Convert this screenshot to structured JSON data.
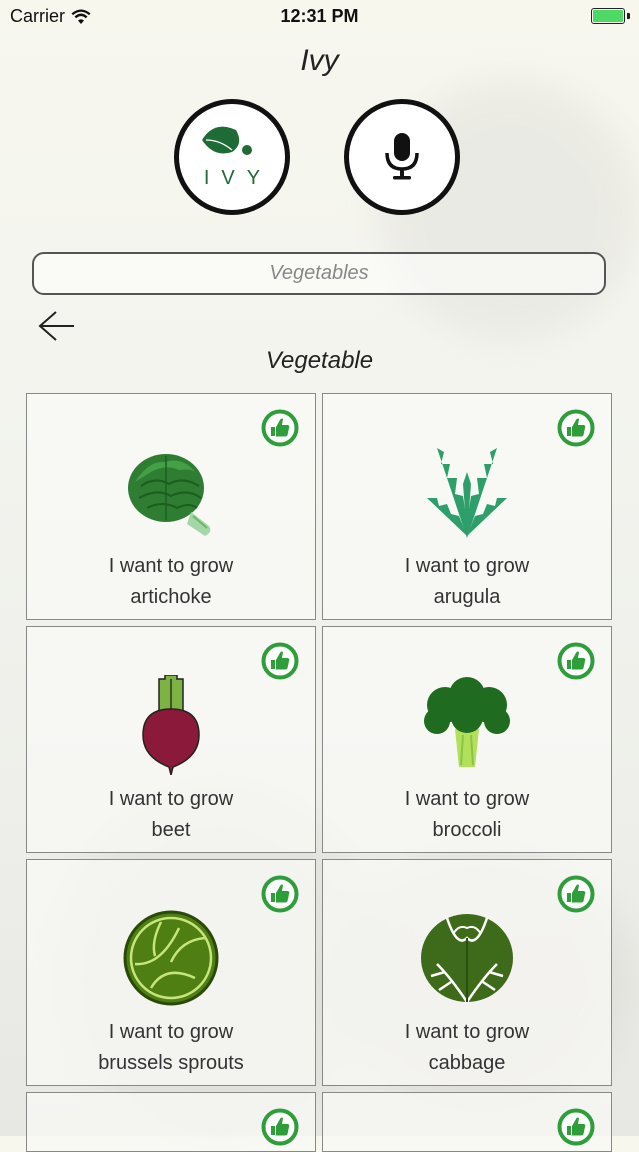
{
  "status_bar": {
    "carrier": "Carrier",
    "time": "12:31 PM"
  },
  "header": {
    "title": "Ivy",
    "logo_text": "IVY"
  },
  "search": {
    "placeholder": "Vegetables"
  },
  "section": {
    "title": "Vegetable"
  },
  "cards": [
    {
      "line1": "I want to grow",
      "line2": "artichoke",
      "icon": "artichoke-icon"
    },
    {
      "line1": "I want to grow",
      "line2": "arugula",
      "icon": "arugula-icon"
    },
    {
      "line1": "I want to grow",
      "line2": "beet",
      "icon": "beet-icon"
    },
    {
      "line1": "I want to grow",
      "line2": "broccoli",
      "icon": "broccoli-icon"
    },
    {
      "line1": "I want to grow",
      "line2": "brussels sprouts",
      "icon": "brussels-sprouts-icon"
    },
    {
      "line1": "I want to grow",
      "line2": "cabbage",
      "icon": "cabbage-icon"
    }
  ],
  "colors": {
    "accent_green": "#2e9e3a",
    "battery_green": "#4cd964",
    "logo_green": "#1f6b35"
  }
}
